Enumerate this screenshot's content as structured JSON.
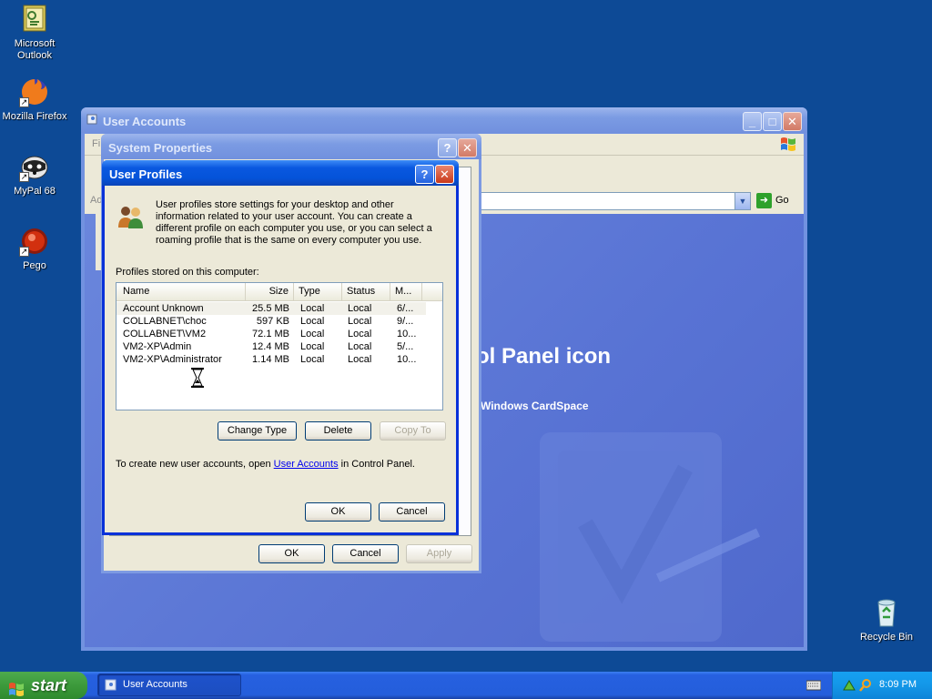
{
  "desktop": {
    "icons": [
      {
        "label": "Microsoft Outlook",
        "line1": "Microsoft",
        "line2": "Outlook",
        "icon": "outlook-icon"
      },
      {
        "label": "Mozilla Firefox",
        "icon": "firefox-icon"
      },
      {
        "label": "MyPal 68",
        "icon": "mypal-icon"
      },
      {
        "label": "Pego",
        "icon": "pego-icon"
      },
      {
        "label": "Recycle Bin",
        "icon": "recycle-bin-icon"
      }
    ]
  },
  "user_accounts": {
    "title": "User Accounts",
    "menu_fragment": "Fi",
    "address_fragment": "Ad",
    "go_label": "Go",
    "panel_title": "ol Panel icon",
    "panel_subtitle": "Windows CardSpace"
  },
  "system_properties": {
    "title": "System Properties",
    "ok": "OK",
    "cancel": "Cancel",
    "apply": "Apply"
  },
  "user_profiles": {
    "title": "User Profiles",
    "description": "User profiles store settings for your desktop and other information related to your user account. You can create a different profile on each computer you use, or you can select a roaming profile that is the same on every computer you use.",
    "desc_lines": [
      "User profiles store settings for your desktop and other",
      "information related to your user account. You can create a",
      "different profile on each computer you use, or you can select a",
      "roaming profile that is the same on every computer you use."
    ],
    "list_label": "Profiles stored on this computer:",
    "columns": [
      "Name",
      "Size",
      "Type",
      "Status",
      "M..."
    ],
    "rows": [
      {
        "name": "Account Unknown",
        "size": "25.5 MB",
        "type": "Local",
        "status": "Local",
        "modified": "6/..."
      },
      {
        "name": "COLLABNET\\choc",
        "size": "597 KB",
        "type": "Local",
        "status": "Local",
        "modified": "9/..."
      },
      {
        "name": "COLLABNET\\VM2",
        "size": "72.1 MB",
        "type": "Local",
        "status": "Local",
        "modified": "10..."
      },
      {
        "name": "VM2-XP\\Admin",
        "size": "12.4 MB",
        "type": "Local",
        "status": "Local",
        "modified": "5/..."
      },
      {
        "name": "VM2-XP\\Administrator",
        "size": "1.14 MB",
        "type": "Local",
        "status": "Local",
        "modified": "10..."
      }
    ],
    "change_type": "Change Type",
    "delete": "Delete",
    "copy_to": "Copy To",
    "footer_prefix": "To create new user accounts, open ",
    "footer_link": "User Accounts",
    "footer_suffix": " in Control Panel.",
    "ok": "OK",
    "cancel": "Cancel"
  },
  "taskbar": {
    "start_label": "start",
    "task_label": "User Accounts",
    "clock": "8:09 PM"
  },
  "colors": {
    "desktop": "#0d4a96",
    "title_active": "#0453d9",
    "start_green": "#3c9a3b",
    "link": "#0000ee"
  }
}
